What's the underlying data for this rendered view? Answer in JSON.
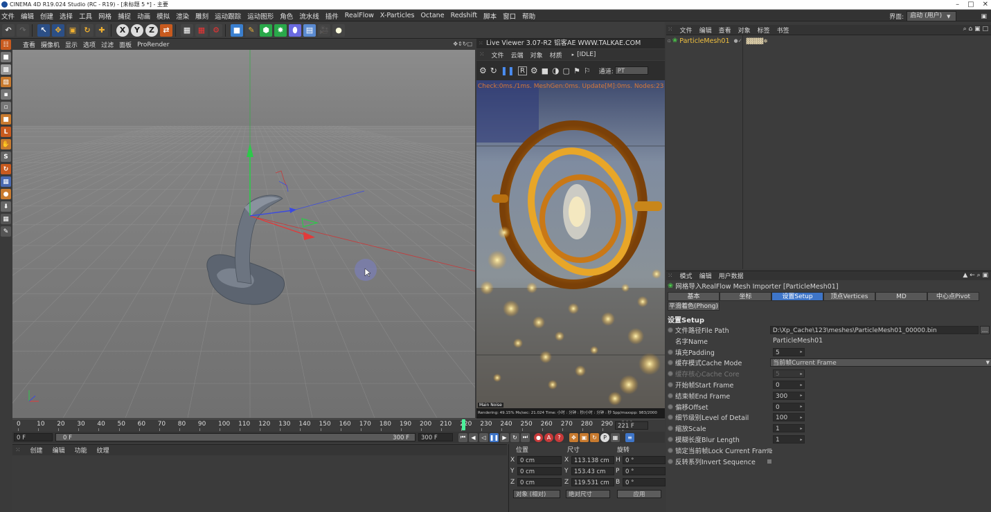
{
  "titlebar": {
    "title": "CINEMA 4D R19.024 Studio (RC - R19) - [未标题 5 *] - 主要"
  },
  "menubar": {
    "items": [
      "文件",
      "编辑",
      "创建",
      "选择",
      "工具",
      "网格",
      "捕捉",
      "动画",
      "模拟",
      "渲染",
      "雕刻",
      "运动跟踪",
      "运动图形",
      "角色",
      "流水线",
      "插件",
      "RealFlow",
      "X-Particles",
      "Octane",
      "Redshift",
      "脚本",
      "窗口",
      "帮助"
    ],
    "layout_label": "界面:",
    "layout_value": "启动 (用户)"
  },
  "toolbar": {
    "axis_x": "X",
    "axis_y": "Y",
    "axis_z": "Z"
  },
  "viewport": {
    "menu": [
      "查看",
      "摄像机",
      "显示",
      "选项",
      "过滤",
      "面板",
      "ProRender"
    ]
  },
  "liveviewer": {
    "title": "Live Viewer 3.07-R2 铝客AE WWW.TALKAE.COM",
    "menu": [
      "文件",
      "云端",
      "对象",
      "材质"
    ],
    "status": "[IDLE]",
    "channel_label": "通道:",
    "channel_value": "PT",
    "overlay": "Check:0ms./1ms. MeshGen:0ms. Update[M]:0ms. Nodes:23 M",
    "bottom_status": "Rendering: 49.15%  Ms/sec: 21.024  Time: 小时 : 分钟 : 秒/小时 : 分钟 : 秒  Spp/maxspp: 983/2000",
    "logo": "Main  Noise"
  },
  "timeline": {
    "ticks": [
      "0",
      "10",
      "20",
      "30",
      "40",
      "50",
      "60",
      "70",
      "80",
      "90",
      "100",
      "110",
      "120",
      "130",
      "140",
      "150",
      "160",
      "170",
      "180",
      "190",
      "200",
      "210",
      "220",
      "230",
      "240",
      "250",
      "260",
      "270",
      "280",
      "290",
      "300"
    ],
    "current_frame_display": "221 F",
    "start_field": "0 F",
    "range_start": "0 F",
    "range_end": "300 F",
    "end_field": "300 F",
    "playhead_frame": 221
  },
  "material": {
    "menu": [
      "创建",
      "编辑",
      "功能",
      "纹理"
    ]
  },
  "coords": {
    "headers": [
      "位置",
      "尺寸",
      "旋转"
    ],
    "rows": [
      {
        "axis": "X",
        "pos": "0 cm",
        "saxis": "X",
        "size": "113.138 cm",
        "raxis": "H",
        "rot": "0 °"
      },
      {
        "axis": "Y",
        "pos": "0 cm",
        "saxis": "Y",
        "size": "153.43 cm",
        "raxis": "P",
        "rot": "0 °"
      },
      {
        "axis": "Z",
        "pos": "0 cm",
        "saxis": "Z",
        "size": "119.531 cm",
        "raxis": "B",
        "rot": "0 °"
      }
    ],
    "mode": "对象 (相对)",
    "size_mode": "绝对尺寸",
    "apply": "应用"
  },
  "objects": {
    "menu": [
      "文件",
      "编辑",
      "查看",
      "对象",
      "标签",
      "书签"
    ],
    "items": [
      {
        "name": "ParticleMesh01"
      }
    ]
  },
  "attributes": {
    "menu": [
      "模式",
      "编辑",
      "用户数据"
    ],
    "object_title": "网格导入RealFlow Mesh Importer [ParticleMesh01]",
    "tabs": [
      "基本",
      "坐标",
      "设置Setup",
      "顶点Vertices",
      "MD",
      "中心点Pivot"
    ],
    "active_tab": "设置Setup",
    "tab2": "平滑着色(Phong)",
    "section": "设置Setup",
    "props": [
      {
        "label": "文件路径File Path",
        "value": "D:\\Xp_Cache\\123\\meshes\\ParticleMesh01_00000.bin"
      },
      {
        "label": "名字Name",
        "value": "ParticleMesh01"
      },
      {
        "label": "填充Padding",
        "value": "5"
      },
      {
        "label": "缓存模式Cache Mode",
        "value": "当前帧Current Frame"
      },
      {
        "label": "缓存核心Cache Core",
        "value": "5"
      },
      {
        "label": "开始帧Start Frame",
        "value": "0"
      },
      {
        "label": "结束帧End Frame",
        "value": "300"
      },
      {
        "label": "偏移Offset",
        "value": "0"
      },
      {
        "label": "细节级别Level of Detail",
        "value": "100"
      },
      {
        "label": "缩放Scale",
        "value": "1"
      },
      {
        "label": "模糊长度Blur Length",
        "value": "1"
      },
      {
        "label": "锁定当前帧Lock Current Frame",
        "value": ""
      },
      {
        "label": "反转系列Invert Sequence",
        "value": ""
      }
    ]
  },
  "colors": {
    "accent": "#3e75c8",
    "panel": "#3c3c3c",
    "viewport": "#8a8a8a"
  }
}
